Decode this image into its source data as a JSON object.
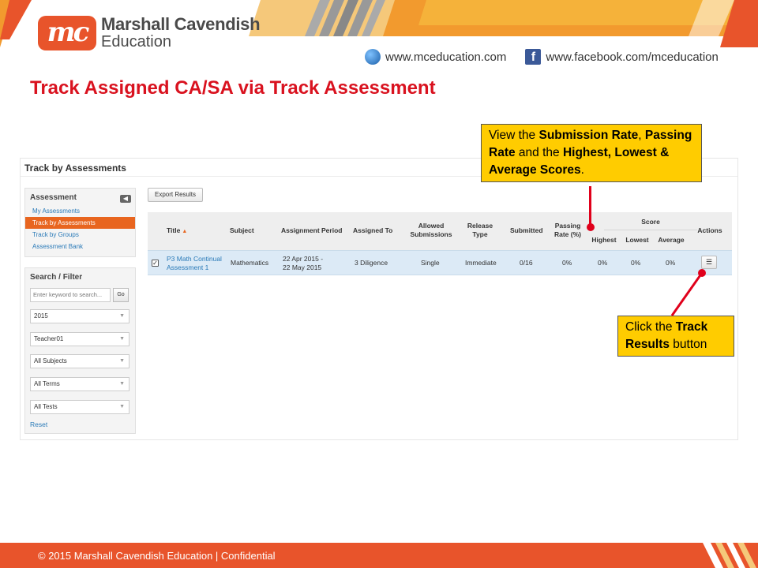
{
  "brand": {
    "logo_text": "mc",
    "name_line1": "Marshall Cavendish",
    "name_line2": "Education",
    "website": "www.mceducation.com",
    "facebook": "www.facebook.com/mceducation",
    "logo_color": "#e8542b"
  },
  "slide_title": "Track Assigned CA/SA via Track Assessment",
  "app": {
    "page_title": "Track by Assessments",
    "sidebar": {
      "heading": "Assessment",
      "items": [
        {
          "label": "My Assessments",
          "active": false
        },
        {
          "label": "Track by Assessments",
          "active": true
        },
        {
          "label": "Track by Groups",
          "active": false
        },
        {
          "label": "Assessment Bank",
          "active": false
        }
      ]
    },
    "filter": {
      "heading": "Search / Filter",
      "keyword_placeholder": "Enter keyword to search...",
      "go_label": "Go",
      "selects": [
        "2015",
        "Teacher01",
        "All Subjects",
        "All Terms",
        "All Tests"
      ],
      "reset_label": "Reset"
    },
    "export_label": "Export Results",
    "table": {
      "headers": {
        "title": "Title",
        "subject": "Subject",
        "period": "Assignment Period",
        "assigned_to": "Assigned To",
        "allowed": "Allowed Submissions",
        "release": "Release Type",
        "submitted": "Submitted",
        "passing": "Passing Rate (%)",
        "score": "Score",
        "highest": "Highest",
        "lowest": "Lowest",
        "average": "Average",
        "actions": "Actions"
      },
      "row": {
        "checked": true,
        "title": "P3 Math Continual Assessment 1",
        "subject": "Mathematics",
        "period": "22 Apr 2015 - 22 May 2015",
        "assigned_to": "3 Diligence",
        "allowed": "Single",
        "release": "Immediate",
        "submitted": "0/16",
        "passing": "0%",
        "highest": "0%",
        "lowest": "0%",
        "average": "0%"
      }
    }
  },
  "callouts": {
    "score_note": {
      "p1": "View the ",
      "b1": "Submission Rate",
      "p2": ", ",
      "b2": "Passing Rate",
      "p3": " and the ",
      "b3": "Highest, Lowest & Average Scores",
      "p4": "."
    },
    "track_note": {
      "p1": "Click the ",
      "b1": "Track Results",
      "p2": " button"
    }
  },
  "footer": "© 2015 Marshall Cavendish Education | Confidential",
  "colors": {
    "accent_orange": "#e8651f",
    "title_red": "#d9121f",
    "callout_yellow": "#ffcc00",
    "connector_red": "#e0001b",
    "link_blue": "#2a7ab8"
  },
  "icons": [
    "sort-asc-icon",
    "collapse-arrow-icon",
    "globe-icon",
    "facebook-icon",
    "list-icon",
    "checkbox-icon",
    "dropdown-caret-icon"
  ]
}
